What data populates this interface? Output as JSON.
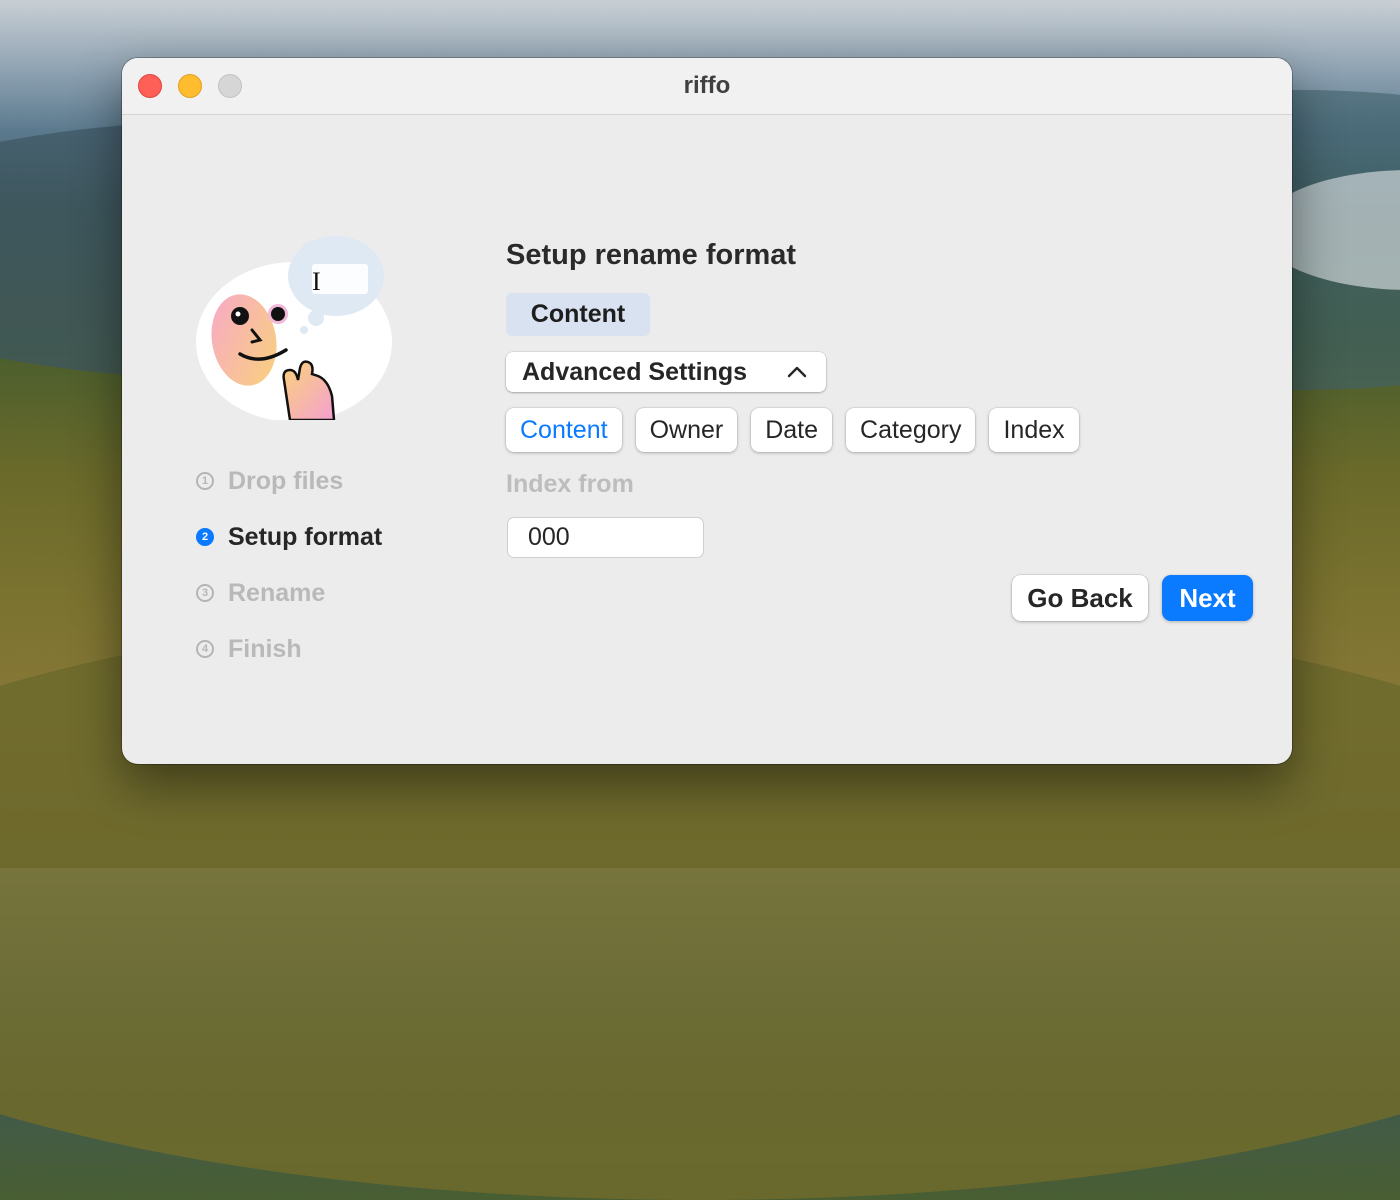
{
  "window": {
    "title": "riffo"
  },
  "steps": [
    {
      "num": "1",
      "label": "Drop files",
      "state": "inactive"
    },
    {
      "num": "2",
      "label": "Setup format",
      "state": "active"
    },
    {
      "num": "3",
      "label": "Rename",
      "state": "inactive"
    },
    {
      "num": "4",
      "label": "Finish",
      "state": "inactive"
    }
  ],
  "main": {
    "heading": "Setup rename format",
    "format_token": "Content",
    "advanced_label": "Advanced Settings",
    "chips": [
      "Content",
      "Owner",
      "Date",
      "Category",
      "Index"
    ],
    "selected_chip": "Content",
    "index_from_label": "Index from",
    "index_from_value": "000"
  },
  "buttons": {
    "back": "Go Back",
    "next": "Next"
  },
  "colors": {
    "accent": "#0a7aff",
    "token_bg": "#d9e2f0"
  }
}
